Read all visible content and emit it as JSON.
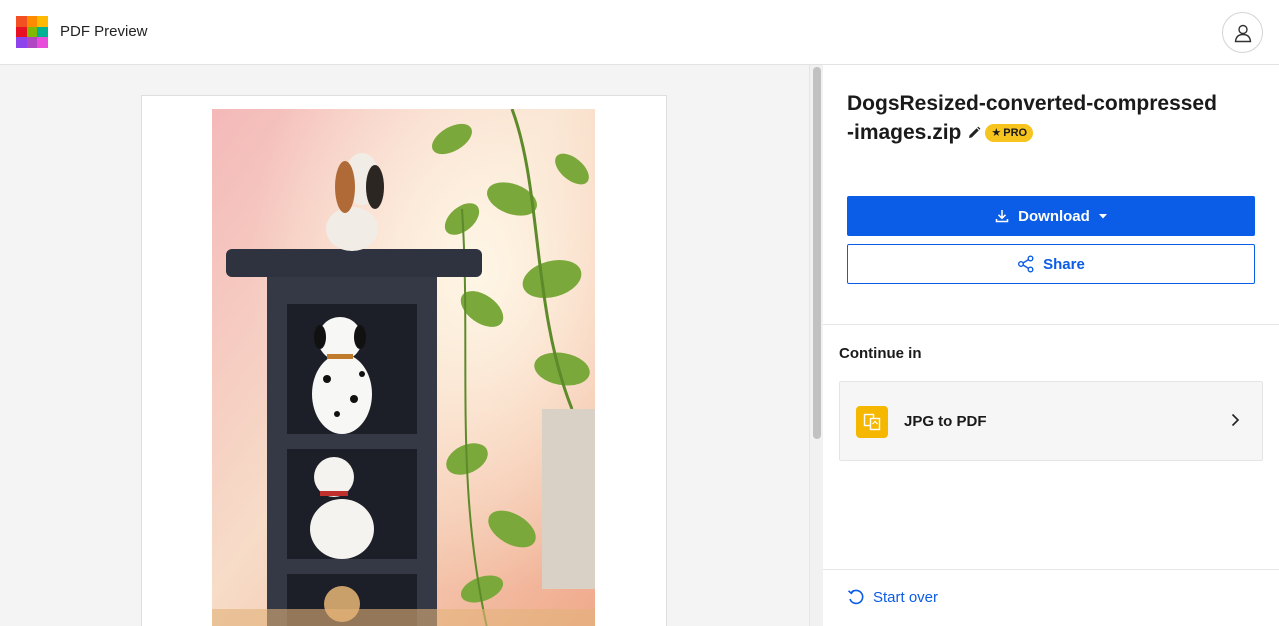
{
  "header": {
    "app_title": "PDF Preview",
    "logo_colors": [
      "#f25022",
      "#ff8c00",
      "#ffb900",
      "#e81123",
      "#7fba00",
      "#00b294",
      "#8e44ec",
      "#b146c2",
      "#e74cda"
    ],
    "avatar_icon": "user-icon"
  },
  "viewer": {
    "page_image": "dogs-on-shelf-photo"
  },
  "panel": {
    "file_name": "DogsResized-converted-compressed-images.zip",
    "edit_icon": "pencil-icon",
    "pro_badge": "PRO",
    "download_label": "Download",
    "share_label": "Share",
    "continue_heading": "Continue in",
    "tools": [
      {
        "label": "JPG to PDF",
        "icon": "jpg-to-pdf-icon"
      }
    ],
    "start_over_label": "Start over"
  },
  "colors": {
    "primary": "#0b5ce6",
    "pro_badge": "#f7c31d",
    "tool_icon": "#f6b701"
  }
}
